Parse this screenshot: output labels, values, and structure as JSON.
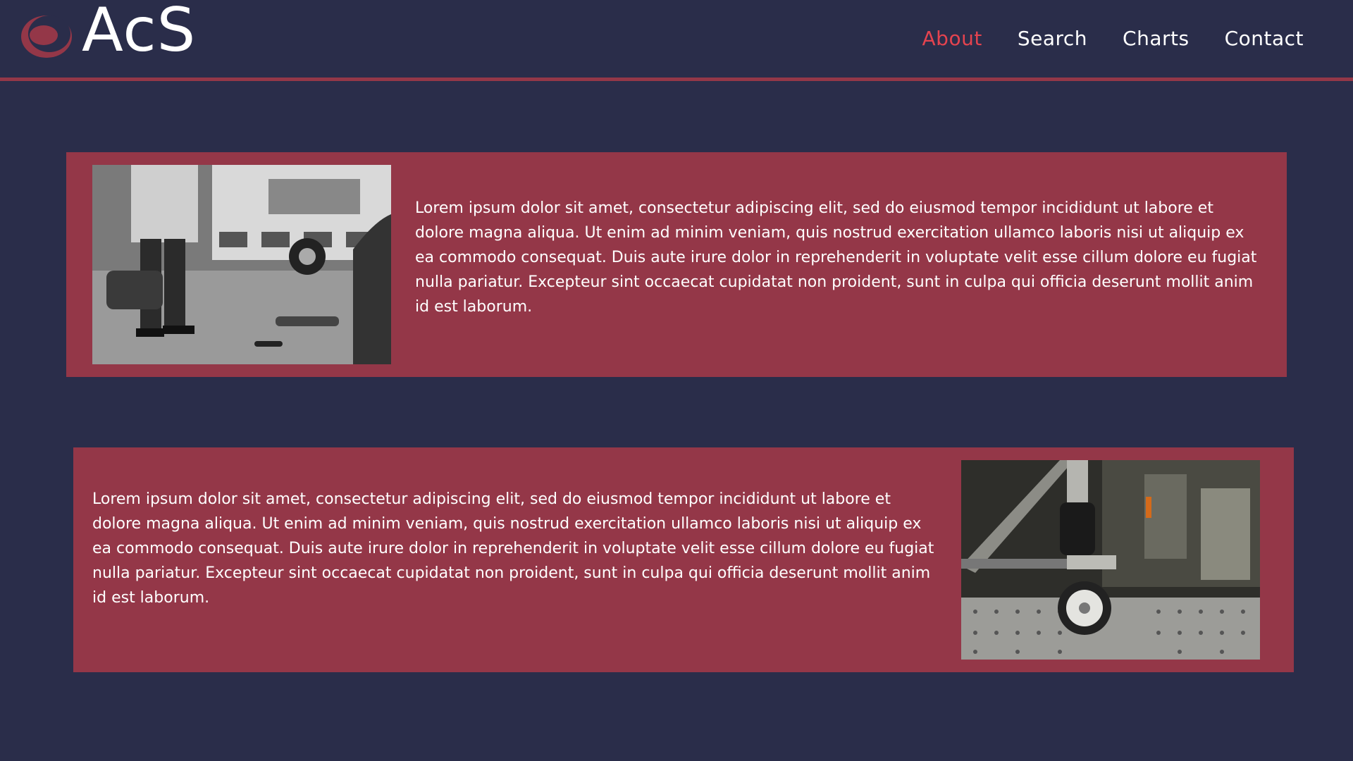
{
  "brand": {
    "name": "AcS",
    "logo_icon": "eye-logo-icon",
    "accent_color": "#943748"
  },
  "nav": {
    "items": [
      {
        "label": "About",
        "active": true
      },
      {
        "label": "Search",
        "active": false
      },
      {
        "label": "Charts",
        "active": false
      },
      {
        "label": "Contact",
        "active": false
      }
    ],
    "active_color": "#e4434f"
  },
  "sections": [
    {
      "image": "ambulance-scene-photo",
      "text": "Lorem ipsum dolor sit amet, consectetur adipiscing elit, sed do eiusmod tempor incididunt ut labore et dolore magna aliqua. Ut enim ad minim veniam, quis nostrud exercitation ullamco laboris nisi ut aliquip ex ea commodo consequat. Duis aute irure dolor in reprehenderit in voluptate velit esse cillum dolore eu fugiat nulla pariatur. Excepteur sint occaecat cupidatat non proident, sunt in culpa qui officia deserunt mollit anim id est laborum."
    },
    {
      "image": "stretcher-wheel-photo",
      "text": "Lorem ipsum dolor sit amet, consectetur adipiscing elit, sed do eiusmod tempor incididunt ut labore et dolore magna aliqua. Ut enim ad minim veniam, quis nostrud exercitation ullamco laboris nisi ut aliquip ex ea commodo consequat. Duis aute irure dolor in reprehenderit in voluptate velit esse cillum dolore eu fugiat nulla pariatur. Excepteur sint occaecat cupidatat non proident, sunt in culpa qui officia deserunt mollit anim id est laborum."
    }
  ],
  "colors": {
    "background": "#2a2d4a",
    "card": "#943748",
    "text": "#ffffff"
  }
}
